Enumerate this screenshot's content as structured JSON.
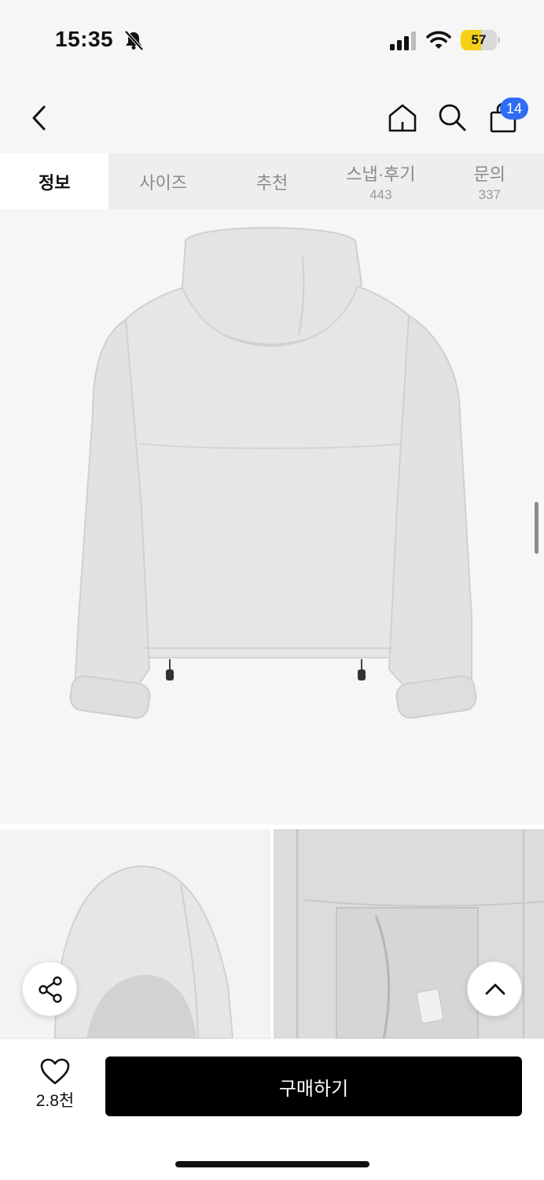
{
  "status_bar": {
    "time": "15:35",
    "battery": "57",
    "battery_color": "#f5d016"
  },
  "header": {
    "back_icon": "chevron-left-icon",
    "home_icon": "home-icon",
    "search_icon": "search-icon",
    "cart_icon": "shopping-bag-icon",
    "cart_count": "14",
    "badge_color": "#2f6df6"
  },
  "tabs": [
    {
      "label": "정보",
      "count": "",
      "active": true
    },
    {
      "label": "사이즈",
      "count": ""
    },
    {
      "label": "추천",
      "count": ""
    },
    {
      "label": "스냅·후기",
      "count": "443"
    },
    {
      "label": "문의",
      "count": "337"
    }
  ],
  "main_image": {
    "description_icon": "hooded-jacket-back-image",
    "jacket_color": "#e6e6e4"
  },
  "floating": {
    "share_icon": "share-icon",
    "scroll_top_icon": "chevron-up-icon"
  },
  "bottom_bar": {
    "like_icon": "heart-icon",
    "like_count": "2.8천",
    "buy_label": "구매하기"
  }
}
